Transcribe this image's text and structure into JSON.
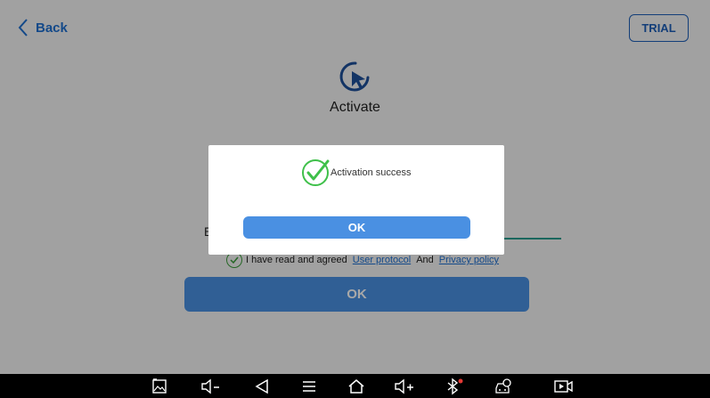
{
  "header": {
    "back_label": "Back",
    "trial_label": "TRIAL"
  },
  "page": {
    "title": "Activate",
    "email_label_partial": "E",
    "agreement": {
      "prefix": "I have read and agreed",
      "user_protocol": "User protocol",
      "and": "And",
      "privacy_policy": "Privacy policy"
    },
    "ok_label": "OK"
  },
  "dialog": {
    "message": "Activation success",
    "ok_label": "OK"
  },
  "nav_bar": {
    "icons": [
      "screenshot-icon",
      "volume-down-icon",
      "back-icon",
      "menu-icon",
      "home-icon",
      "volume-up-icon",
      "bluetooth-icon",
      "vci-icon",
      "screen-record-icon"
    ]
  },
  "colors": {
    "accent": "#4a90e2",
    "link": "#1e6fd1",
    "success": "#3fc04a",
    "navbar": "#000000"
  }
}
